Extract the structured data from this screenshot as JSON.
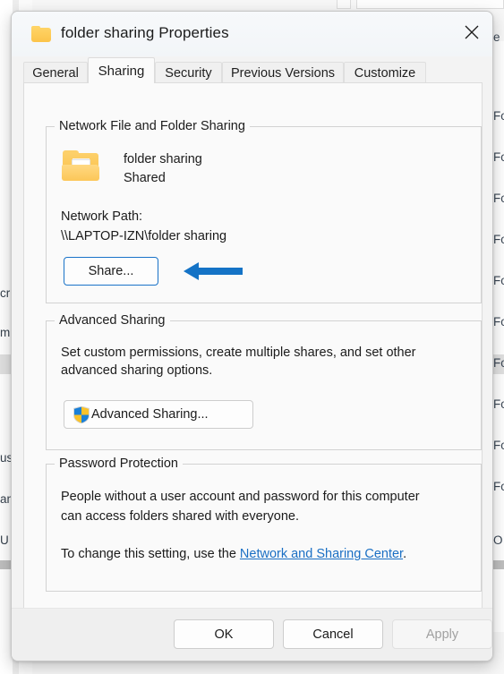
{
  "window": {
    "title": "folder sharing Properties",
    "folder_icon": "folder-icon",
    "close_icon": "close-icon"
  },
  "tabs": [
    {
      "label": "General",
      "active": false
    },
    {
      "label": "Sharing",
      "active": true
    },
    {
      "label": "Security",
      "active": false
    },
    {
      "label": "Previous Versions",
      "active": false
    },
    {
      "label": "Customize",
      "active": false
    }
  ],
  "network_sharing": {
    "group_title": "Network File and Folder Sharing",
    "folder_icon": "shared-folder-icon",
    "folder_name": "folder sharing",
    "share_status": "Shared",
    "network_path_label": "Network Path:",
    "network_path_value": "\\\\LAPTOP-IZN\\folder sharing",
    "share_button": "Share..."
  },
  "advanced_sharing": {
    "group_title": "Advanced Sharing",
    "description_line1": "Set custom permissions, create multiple shares, and set other",
    "description_line2": "advanced sharing options.",
    "button_label": "Advanced Sharing...",
    "button_icon": "uac-shield-icon"
  },
  "password_protection": {
    "group_title": "Password Protection",
    "description_line1": "People without a user account and password for this computer",
    "description_line2": "can access folders shared with everyone.",
    "setting_prefix": "To change this setting, use the ",
    "link_text": "Network and Sharing Center",
    "setting_suffix": "."
  },
  "annotation": {
    "arrow_icon": "left-arrow-annotation",
    "color": "#1473c6",
    "points_to": "Share..."
  },
  "footer": {
    "ok": "OK",
    "cancel": "Cancel",
    "apply": "Apply",
    "apply_disabled": true
  },
  "background": {
    "left_fragments": [
      "cr",
      "m",
      "us",
      "an",
      "U"
    ],
    "right_fragments": [
      "e",
      "Fo",
      "Fo",
      "Fo",
      "Fo",
      "Fo",
      "Fo",
      "Fo",
      "Fo",
      "Fo",
      "Fo",
      "O"
    ]
  },
  "colors": {
    "accent": "#1473c6",
    "link": "#1a6fc4",
    "dialog_bg": "#f3f3f3",
    "content_bg": "#fafafa",
    "folder_yellow": "#fcc44a"
  }
}
